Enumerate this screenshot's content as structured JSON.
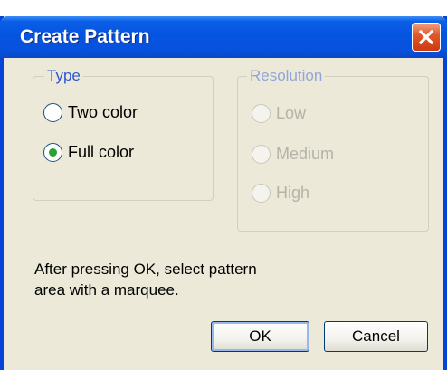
{
  "dialog": {
    "title": "Create Pattern",
    "close_icon": "close-icon"
  },
  "type_group": {
    "legend": "Type",
    "options": [
      {
        "label": "Two color",
        "selected": false
      },
      {
        "label": "Full color",
        "selected": true
      }
    ]
  },
  "resolution_group": {
    "legend": "Resolution",
    "enabled": false,
    "options": [
      {
        "label": "Low",
        "selected": false
      },
      {
        "label": "Medium",
        "selected": false
      },
      {
        "label": "High",
        "selected": false
      }
    ]
  },
  "message": {
    "line1": "After pressing OK, select pattern",
    "line2": "area with a marquee."
  },
  "buttons": {
    "ok": "OK",
    "cancel": "Cancel"
  },
  "colors": {
    "titlebar": "#0554e0",
    "dialog_bg": "#ece9d8",
    "legend_text": "#2f57d3",
    "close_button": "#e05a2e"
  }
}
